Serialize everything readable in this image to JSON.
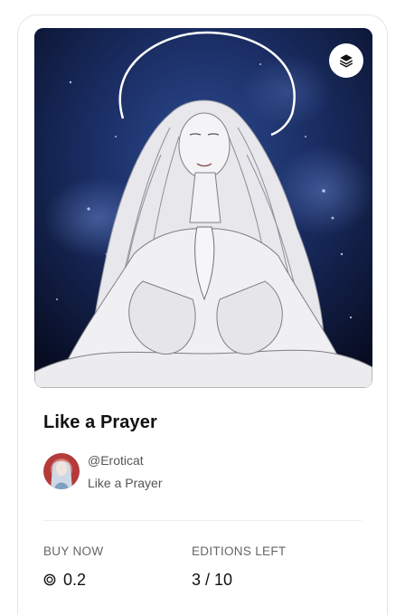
{
  "card": {
    "title": "Like a Prayer",
    "creator_handle": "@Eroticat",
    "creator_subtitle": "Like a Prayer",
    "layers_icon": "layers-icon"
  },
  "stats": {
    "buy_label": "BUY NOW",
    "price": "0.2",
    "currency_icon": "tezos-icon",
    "editions_label": "EDITIONS LEFT",
    "editions": "3 / 10"
  },
  "colors": {
    "title": "#111111",
    "secondary_text": "#555555",
    "divider": "#eeeeee",
    "artwork_background": "#0b1430"
  }
}
